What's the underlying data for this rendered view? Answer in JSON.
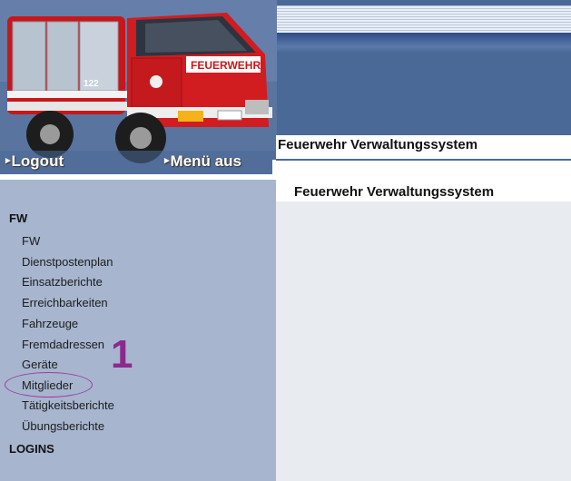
{
  "header": {
    "title": "Feuerwehr Verwaltungssystem",
    "nav": {
      "logout_label": "Logout",
      "menu_off_label": "Menü aus",
      "arrow_glyph": "▸"
    },
    "truck_door_text": "FEUERWEHR",
    "truck_number": "122"
  },
  "sidebar": {
    "groups": [
      {
        "heading": "FW",
        "items": [
          "FW",
          "Dienstpostenplan",
          "Einsatzberichte",
          "Erreichbarkeiten",
          "Fahrzeuge",
          "Fremdadressen",
          "Geräte",
          "Mitglieder",
          "Tätigkeitsberichte",
          "Übungsberichte"
        ]
      },
      {
        "heading": "LOGINS",
        "items": []
      }
    ]
  },
  "annotation": {
    "number": "1",
    "color": "#8a2b8c",
    "highlighted_item": "Mitglieder"
  },
  "main": {
    "title": "Feuerwehr Verwaltungssystem"
  },
  "colors": {
    "header_blue": "#4b6997",
    "sidebar_bg": "#a7b5cf",
    "truck_red": "#c8171b"
  }
}
